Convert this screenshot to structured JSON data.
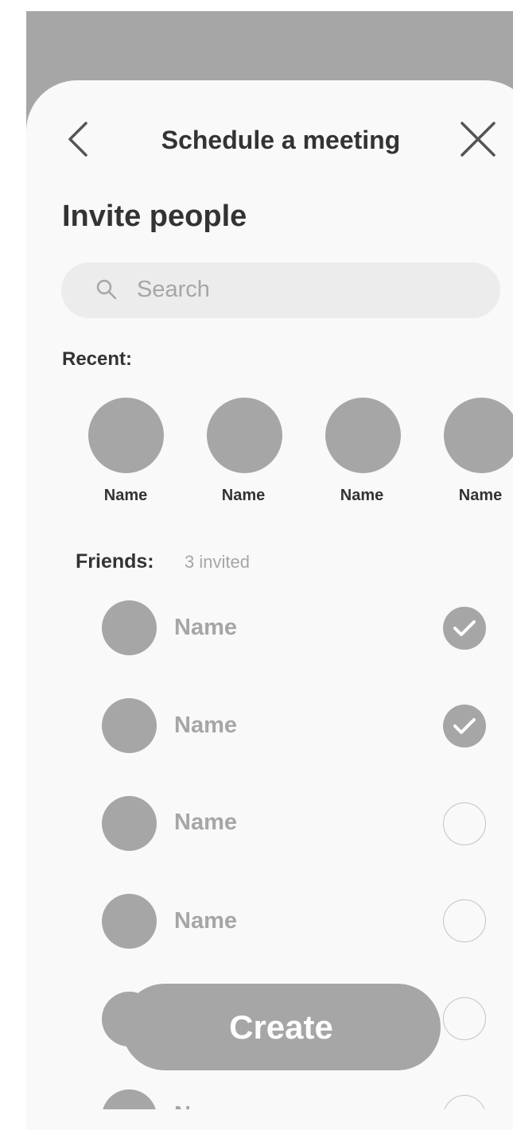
{
  "header": {
    "title": "Schedule a meeting",
    "back_icon": "chevron-left-icon",
    "close_icon": "close-icon"
  },
  "invite": {
    "heading": "Invite people",
    "search_placeholder": "Search"
  },
  "recent": {
    "label": "Recent:",
    "items": [
      {
        "name": "Name"
      },
      {
        "name": "Name"
      },
      {
        "name": "Name"
      },
      {
        "name": "Name"
      }
    ]
  },
  "friends": {
    "label": "Friends:",
    "invited_count": "3 invited",
    "items": [
      {
        "name": "Name",
        "checked": true
      },
      {
        "name": "Name",
        "checked": true
      },
      {
        "name": "Name",
        "checked": false
      },
      {
        "name": "Name",
        "checked": false
      },
      {
        "name": "",
        "checked": false
      },
      {
        "name": "Name",
        "checked": false
      }
    ]
  },
  "footer": {
    "create_label": "Create"
  },
  "colors": {
    "placeholder_gray": "#a6a6a6",
    "text_dark": "#333333",
    "sheet_bg": "#f9f9f9",
    "search_bg": "#ececec"
  }
}
